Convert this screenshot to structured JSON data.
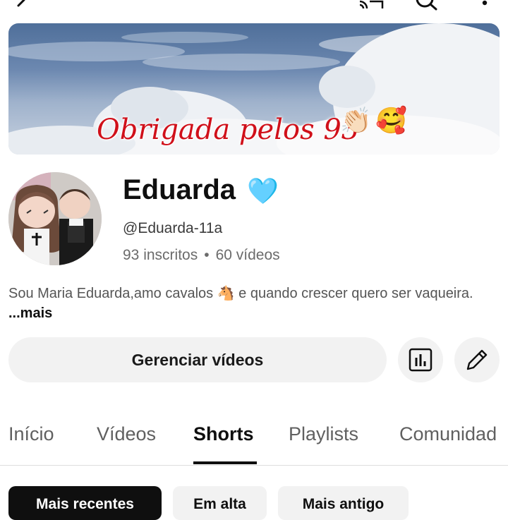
{
  "banner": {
    "text": "Obrigada pelos 93",
    "emoji_clap": "👏🏻",
    "emoji_love": "🥰"
  },
  "channel": {
    "name": "Eduarda",
    "heart": "🩵",
    "handle": "@Eduarda-11a",
    "subscribers": "93 inscritos",
    "separator": "•",
    "videos": "60 vídeos",
    "bio": "Sou Maria Eduarda,amo cavalos 🐴 e quando crescer quero ser vaqueira. ",
    "bio_more": "...mais"
  },
  "actions": {
    "manage_label": "Gerenciar vídeos"
  },
  "tabs": [
    {
      "label": "Início"
    },
    {
      "label": "Vídeos"
    },
    {
      "label": "Shorts"
    },
    {
      "label": "Playlists"
    },
    {
      "label": "Comunidad"
    }
  ],
  "active_tab": "Shorts",
  "chips": [
    {
      "label": "Mais recentes"
    },
    {
      "label": "Em alta"
    },
    {
      "label": "Mais antigo"
    }
  ],
  "icons": {
    "back": "back-arrow-icon",
    "cast": "cast-icon",
    "search": "search-icon",
    "more": "more-vert-icon",
    "analytics": "analytics-icon",
    "edit": "pencil-icon"
  }
}
